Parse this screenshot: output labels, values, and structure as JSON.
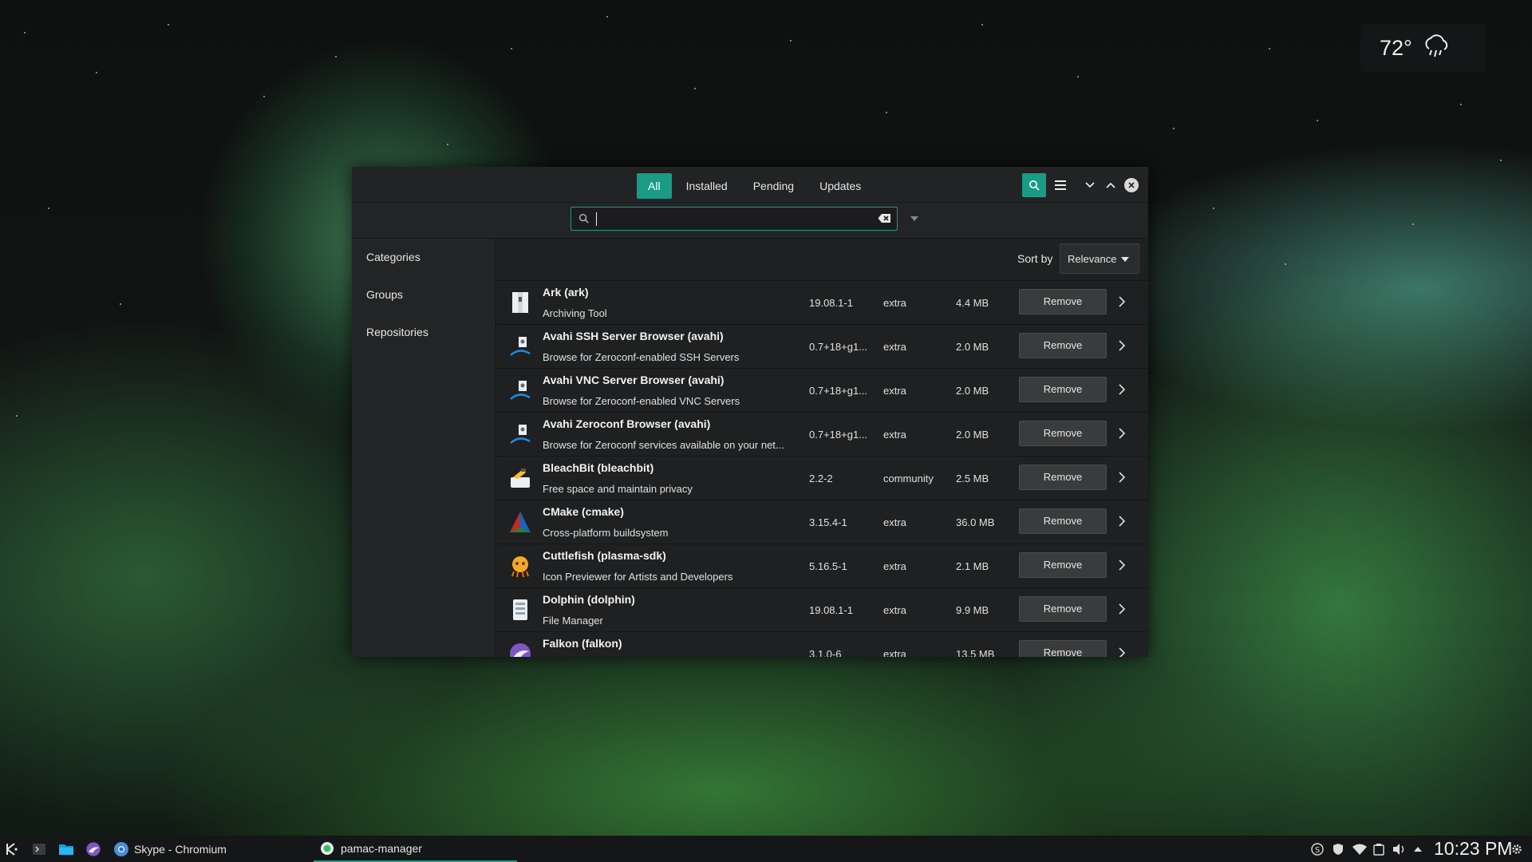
{
  "weather": {
    "temperature": "72°",
    "icon": "rain-cloud-icon"
  },
  "window": {
    "tabs": [
      {
        "label": "All",
        "active": true
      },
      {
        "label": "Installed",
        "active": false
      },
      {
        "label": "Pending",
        "active": false
      },
      {
        "label": "Updates",
        "active": false
      }
    ],
    "search": {
      "value": "",
      "placeholder": ""
    },
    "sidebar": [
      "Categories",
      "Groups",
      "Repositories"
    ],
    "sort": {
      "label": "Sort by",
      "value": "Relevance"
    },
    "packages": [
      {
        "name": "Ark  (ark)",
        "desc": "Archiving Tool",
        "version": "19.08.1-1",
        "repo": "extra",
        "size": "4.4 MB",
        "action": "Remove",
        "icon": "ark-icon"
      },
      {
        "name": "Avahi SSH Server Browser  (avahi)",
        "desc": "Browse for Zeroconf-enabled SSH Servers",
        "version": "0.7+18+g1...",
        "repo": "extra",
        "size": "2.0 MB",
        "action": "Remove",
        "icon": "avahi-icon"
      },
      {
        "name": "Avahi VNC Server Browser  (avahi)",
        "desc": "Browse for Zeroconf-enabled VNC Servers",
        "version": "0.7+18+g1...",
        "repo": "extra",
        "size": "2.0 MB",
        "action": "Remove",
        "icon": "avahi-icon"
      },
      {
        "name": "Avahi Zeroconf Browser  (avahi)",
        "desc": "Browse for Zeroconf services available on your net...",
        "version": "0.7+18+g1...",
        "repo": "extra",
        "size": "2.0 MB",
        "action": "Remove",
        "icon": "avahi-icon"
      },
      {
        "name": "BleachBit  (bleachbit)",
        "desc": "Free space and maintain privacy",
        "version": "2.2-2",
        "repo": "community",
        "size": "2.5 MB",
        "action": "Remove",
        "icon": "bleachbit-icon"
      },
      {
        "name": "CMake  (cmake)",
        "desc": "Cross-platform buildsystem",
        "version": "3.15.4-1",
        "repo": "extra",
        "size": "36.0 MB",
        "action": "Remove",
        "icon": "cmake-icon"
      },
      {
        "name": "Cuttlefish  (plasma-sdk)",
        "desc": "Icon Previewer for Artists and Developers",
        "version": "5.16.5-1",
        "repo": "extra",
        "size": "2.1 MB",
        "action": "Remove",
        "icon": "cuttlefish-icon"
      },
      {
        "name": "Dolphin  (dolphin)",
        "desc": "File Manager",
        "version": "19.08.1-1",
        "repo": "extra",
        "size": "9.9 MB",
        "action": "Remove",
        "icon": "dolphin-icon"
      },
      {
        "name": "Falkon  (falkon)",
        "desc": "",
        "version": "3.1.0-6",
        "repo": "extra",
        "size": "13.5 MB",
        "action": "Remove",
        "icon": "falkon-icon"
      }
    ]
  },
  "taskbar": {
    "tasks": [
      {
        "label": "Skype - Chromium",
        "icon": "chromium-icon"
      },
      {
        "label": "pamac-manager",
        "icon": "pamac-icon"
      }
    ],
    "clock": "10:23 PM"
  },
  "colors": {
    "accent": "#1a9b86",
    "window_bg": "#232425",
    "list_bg": "#1f2021"
  }
}
